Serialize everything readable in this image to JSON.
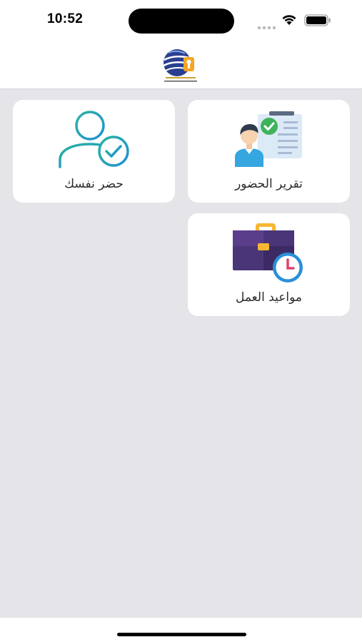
{
  "status_bar": {
    "time": "10:52"
  },
  "header": {
    "logo_icon": "company-globe-logo"
  },
  "cards": [
    {
      "label": "تقرير الحضور",
      "icon": "attendance-report-icon"
    },
    {
      "label": "حضر نفسك",
      "icon": "user-check-icon"
    },
    {
      "label": "مواعيد العمل",
      "icon": "briefcase-clock-icon"
    }
  ],
  "colors": {
    "background": "#e4e4e9",
    "card": "#ffffff",
    "accent_teal": "#2bb3a0",
    "accent_blue": "#1e9bd7",
    "briefcase_purple": "#5a3e8c",
    "briefcase_yellow": "#f5b731"
  }
}
